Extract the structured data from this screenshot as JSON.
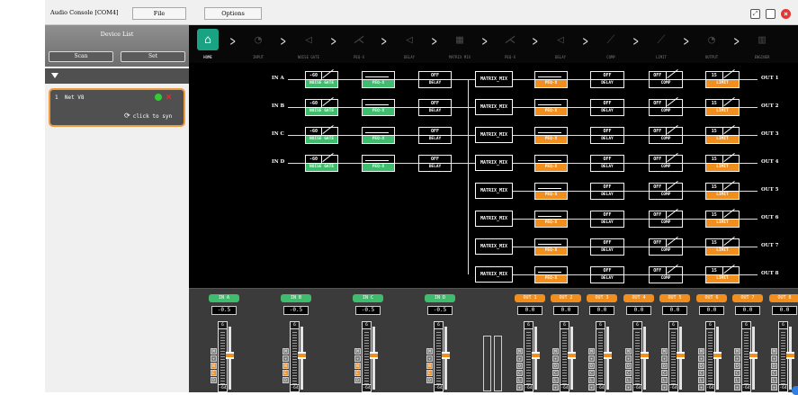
{
  "window": {
    "title": "Audio Console [COM4]",
    "menu": [
      "File",
      "Options"
    ]
  },
  "sidebar": {
    "title": "Device List",
    "scan_label": "Scan",
    "set_label": "Set",
    "device": {
      "index": "1",
      "name": "Net V8",
      "status_color": "#34cc34",
      "sync_label": "click to syn"
    }
  },
  "nav": [
    {
      "label": "HOME",
      "icon": "home-icon",
      "active": true
    },
    {
      "label": "INPUT",
      "icon": "input-icon"
    },
    {
      "label": "NOISE GATE",
      "icon": "noise-gate-icon"
    },
    {
      "label": "PEQ-X",
      "icon": "peq-icon"
    },
    {
      "label": "DELAY",
      "icon": "delay-icon"
    },
    {
      "label": "MATRIX MIX",
      "icon": "matrix-icon"
    },
    {
      "label": "PEQ-X",
      "icon": "peq-icon"
    },
    {
      "label": "DELAY",
      "icon": "delay-icon"
    },
    {
      "label": "COMP",
      "icon": "comp-icon"
    },
    {
      "label": "LIMIT",
      "icon": "limit-icon"
    },
    {
      "label": "OUTPUT",
      "icon": "output-icon"
    },
    {
      "label": "ENGINER",
      "icon": "engineer-icon"
    }
  ],
  "chain": {
    "inputs": [
      "IN A",
      "IN B",
      "IN C",
      "IN D"
    ],
    "gate_value": "-60",
    "gate_label": "NOISE GATE",
    "peq_label": "PEQ-X",
    "delay_value": "OFF",
    "delay_label": "DELAY",
    "matrix_label": "MATRIX_MIX",
    "comp_value": "OFF",
    "comp_label": "COMP",
    "limit_value": "15",
    "limit_label": "LIMIT",
    "outputs": [
      "OUT 1",
      "OUT 2",
      "OUT 3",
      "OUT 4",
      "OUT 5",
      "OUT 6",
      "OUT 7",
      "OUT 8"
    ]
  },
  "mixer": {
    "inputs": [
      {
        "name": "IN A",
        "value": "-0.5",
        "level": 0.55
      },
      {
        "name": "IN B",
        "value": "-0.5",
        "level": 0.55
      },
      {
        "name": "IN C",
        "value": "-0.5",
        "level": 0.55
      },
      {
        "name": "IN D",
        "value": "-0.5",
        "level": 0.55
      }
    ],
    "outputs": [
      {
        "name": "OUT 1",
        "value": "0.0",
        "level": 0.55
      },
      {
        "name": "OUT 2",
        "value": "0.0",
        "level": 0.55
      },
      {
        "name": "OUT 3",
        "value": "0.0",
        "level": 0.55
      },
      {
        "name": "OUT 4",
        "value": "0.0",
        "level": 0.55
      },
      {
        "name": "OUT 5",
        "value": "0.0",
        "level": 0.55
      },
      {
        "name": "OUT 6",
        "value": "0.0",
        "level": 0.55
      },
      {
        "name": "OUT 7",
        "value": "0.0",
        "level": 0.55
      },
      {
        "name": "OUT 8",
        "value": "0.0",
        "level": 0.55
      }
    ],
    "meter_top": "6",
    "meter_bottom": "-64",
    "input_buttons": [
      "M",
      "+",
      "N",
      "E",
      "D"
    ],
    "output_buttons": [
      "M",
      "+",
      "D",
      "C",
      "L",
      "+"
    ],
    "colors": {
      "input": "#3fbc6e",
      "output": "#f28e1e"
    }
  }
}
